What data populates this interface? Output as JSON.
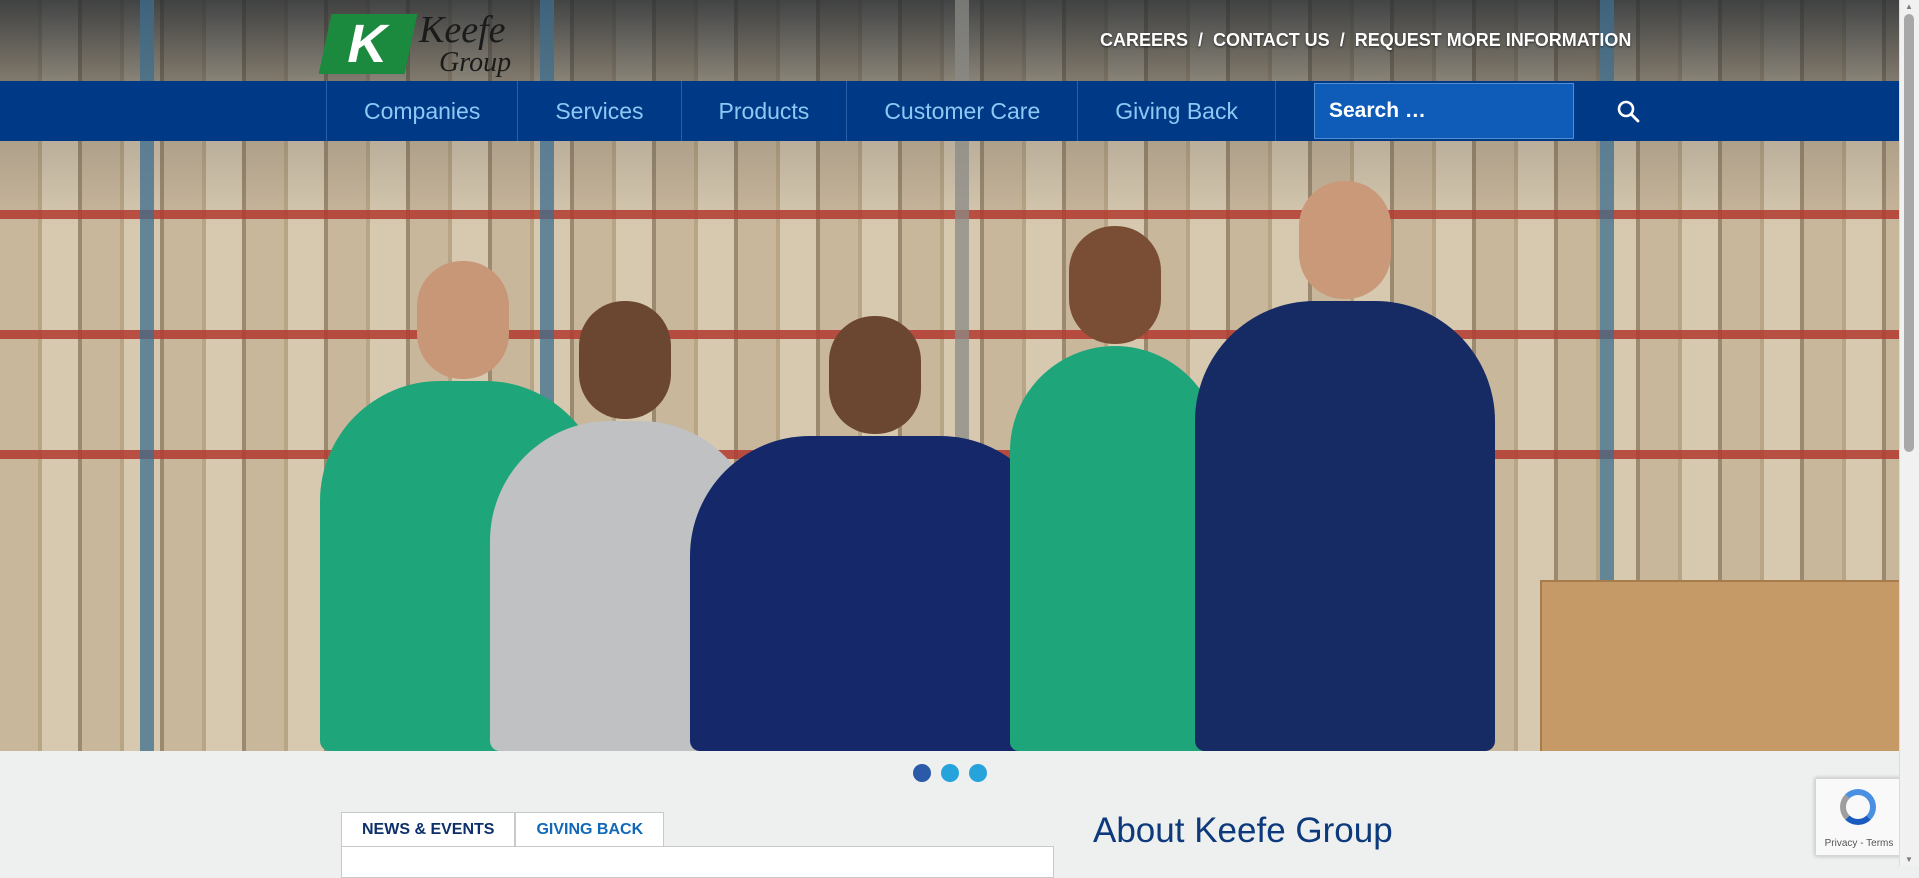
{
  "brand": {
    "logo_letter": "K",
    "name_line1": "Keefe",
    "name_line2": "Group"
  },
  "top_links": [
    {
      "label": "CAREERS"
    },
    {
      "label": "CONTACT US"
    },
    {
      "label": "REQUEST MORE INFORMATION"
    }
  ],
  "top_link_separator": "/",
  "nav": {
    "items": [
      {
        "label": "Companies"
      },
      {
        "label": "Services"
      },
      {
        "label": "Products"
      },
      {
        "label": "Customer Care"
      },
      {
        "label": "Giving Back"
      }
    ]
  },
  "search": {
    "placeholder": "Search …"
  },
  "carousel": {
    "slide_count": 3,
    "active_index": 0
  },
  "tabs": [
    {
      "label": "NEWS & EVENTS",
      "active": true
    },
    {
      "label": "GIVING BACK",
      "active": false
    }
  ],
  "about": {
    "title": "About Keefe Group"
  },
  "recaptcha": {
    "privacy": "Privacy",
    "separator": "-",
    "terms": "Terms"
  },
  "colors": {
    "nav_background": "#003a87",
    "nav_text": "#8ec8f5",
    "brand_green": "#1c8a3e",
    "search_background": "#0f5bb8",
    "dot_active": "#2a5aa8",
    "dot_inactive": "#27a3dc",
    "heading_blue": "#0d3a7c"
  },
  "icons": {
    "search": "search-icon",
    "recaptcha": "recaptcha-logo-icon"
  }
}
